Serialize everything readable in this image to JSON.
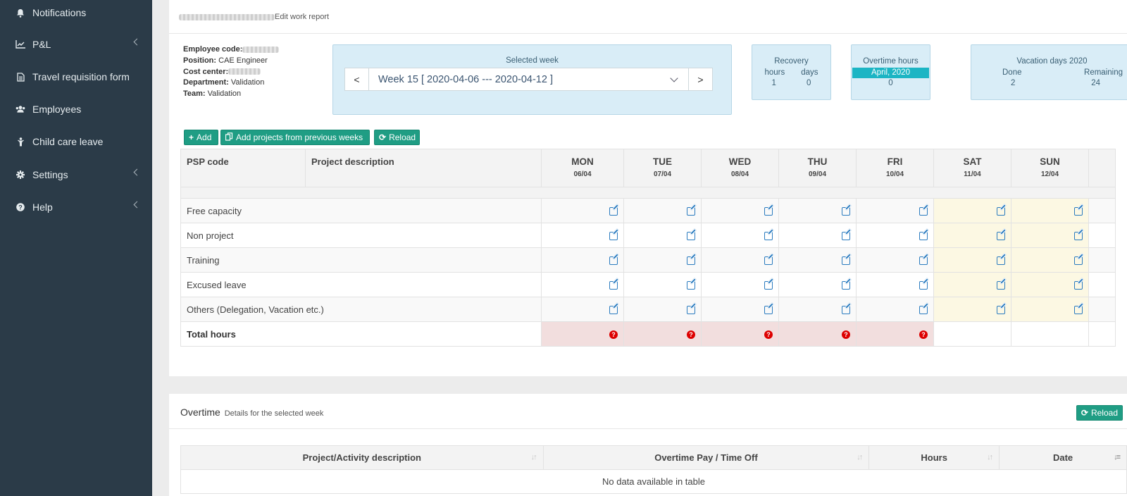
{
  "sidebar": {
    "items": [
      {
        "label": "Notifications",
        "icon": "bell-icon"
      },
      {
        "label": "P&L",
        "icon": "line-chart-icon"
      },
      {
        "label": "Travel requisition form",
        "icon": "document-icon"
      },
      {
        "label": "Employees",
        "icon": "users-icon"
      },
      {
        "label": "Child care leave",
        "icon": "child-icon"
      },
      {
        "label": "Settings",
        "icon": "gear-icon"
      },
      {
        "label": "Help",
        "icon": "question-circle-icon"
      }
    ]
  },
  "report": {
    "title": "Edit work report",
    "employee_code_label": "Employee code:",
    "position_label": "Position:",
    "position_value": "CAE Engineer",
    "cost_center_label": "Cost center:",
    "department_label": "Department:",
    "department_value": "Validation",
    "team_label": "Team:",
    "team_value": "Validation"
  },
  "week": {
    "label": "Selected week",
    "value": "Week 15 [ 2020-04-06 --- 2020-04-12 ]",
    "prev": "<",
    "next": ">"
  },
  "recovery": {
    "title": "Recovery",
    "hours_label": "hours",
    "days_label": "days",
    "hours": "1",
    "days": "0"
  },
  "overtime_box": {
    "title": "Overtime hours",
    "month": "April, 2020",
    "value": "0"
  },
  "vacation": {
    "title": "Vacation days 2020",
    "done_label": "Done",
    "remaining_label": "Remaining",
    "done": "2",
    "remaining": "24"
  },
  "toolbar": {
    "add": "Add",
    "add_previous": "Add projects from previous weeks",
    "reload": "Reload"
  },
  "timesheet": {
    "col_psp": "PSP code",
    "col_desc": "Project description",
    "days": [
      {
        "name": "MON",
        "date": "06/04"
      },
      {
        "name": "TUE",
        "date": "07/04"
      },
      {
        "name": "WED",
        "date": "08/04"
      },
      {
        "name": "THU",
        "date": "09/04"
      },
      {
        "name": "FRI",
        "date": "10/04"
      },
      {
        "name": "SAT",
        "date": "11/04"
      },
      {
        "name": "SUN",
        "date": "12/04"
      }
    ],
    "rows": [
      "Free capacity",
      "Non project",
      "Training",
      "Excused leave",
      "Others (Delegation, Vacation etc.)"
    ],
    "total_label": "Total hours"
  },
  "overtime": {
    "title": "Overtime",
    "subtitle": "Details for the selected week",
    "reload": "Reload",
    "columns": [
      "Project/Activity description",
      "Overtime Pay / Time Off",
      "Hours",
      "Date"
    ],
    "empty": "No data available in table"
  },
  "colors": {
    "sidebar": "#2b3b48",
    "accent": "#1f9d84",
    "info_box": "#d9edf7",
    "weekend": "#fcf8e3",
    "error_row": "#f2dede"
  }
}
